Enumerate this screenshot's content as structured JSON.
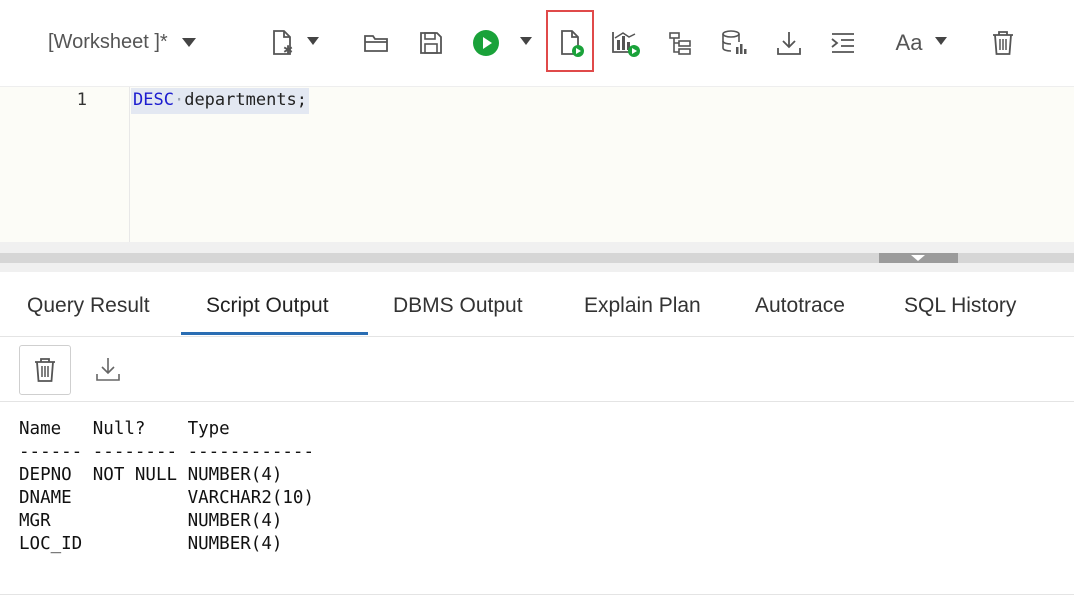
{
  "toolbar": {
    "worksheet_label": "[Worksheet ]*",
    "buttons": [
      {
        "name": "new-file-icon"
      },
      {
        "name": "open-folder-icon"
      },
      {
        "name": "save-icon"
      },
      {
        "name": "run-statement-icon"
      },
      {
        "name": "run-script-icon"
      },
      {
        "name": "explain-plan-icon"
      },
      {
        "name": "autotrace-icon"
      },
      {
        "name": "sql-tuning-icon"
      },
      {
        "name": "download-icon"
      },
      {
        "name": "format-icon"
      },
      {
        "name": "font-case-icon",
        "label": "Aa"
      },
      {
        "name": "clear-icon"
      }
    ],
    "accent_green": "#1aa23a",
    "highlight_color": "#e04a4a"
  },
  "editor": {
    "lines": [
      {
        "number": "1",
        "keyword": "DESC",
        "rest": "departments;"
      }
    ]
  },
  "tabs": [
    {
      "label": "Query Result",
      "active": false
    },
    {
      "label": "Script Output",
      "active": true
    },
    {
      "label": "DBMS Output",
      "active": false
    },
    {
      "label": "Explain Plan",
      "active": false
    },
    {
      "label": "Autotrace",
      "active": false
    },
    {
      "label": "SQL History",
      "active": false
    }
  ],
  "output": {
    "lines": [
      "Name   Null?    Type",
      "------ -------- ------------",
      "DEPNO  NOT NULL NUMBER(4)",
      "DNAME           VARCHAR2(10)",
      "MGR             NUMBER(4)",
      "LOC_ID          NUMBER(4)"
    ]
  }
}
